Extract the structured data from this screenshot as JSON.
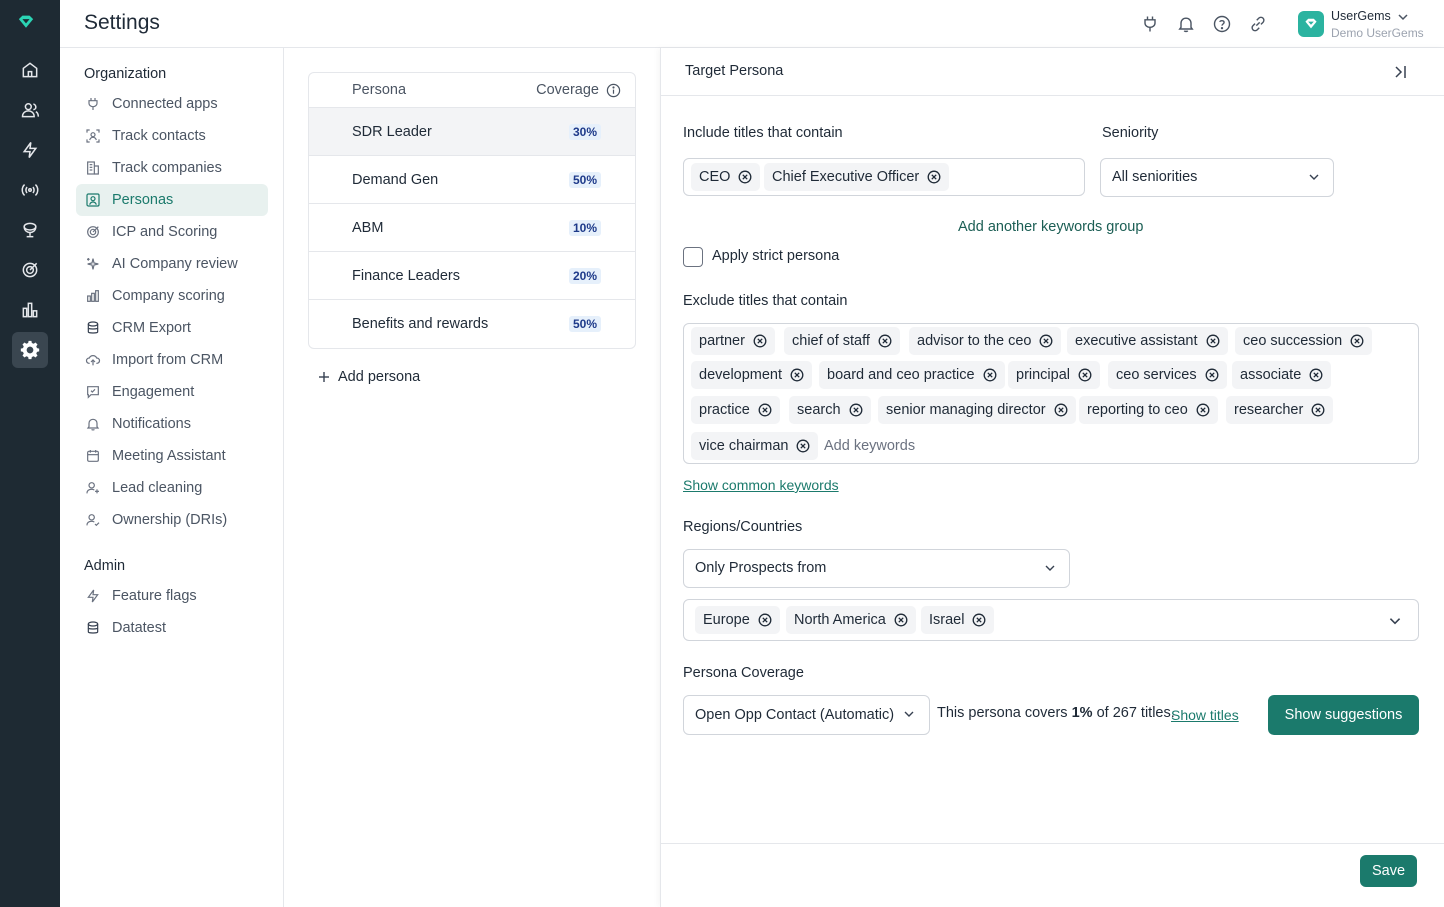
{
  "header": {
    "title": "Settings",
    "user_name": "UserGems",
    "user_org": "Demo UserGems",
    "icons": [
      "plug-icon",
      "bell-icon",
      "help-icon",
      "link-icon"
    ]
  },
  "rail": {
    "icons": [
      "home-icon",
      "people-icon",
      "bolt-icon",
      "signal-icon",
      "trophy-icon",
      "target-icon",
      "chart-icon",
      "gear-icon"
    ],
    "active": "gear-icon"
  },
  "nav": {
    "org_title": "Organization",
    "items": [
      {
        "label": "Connected apps",
        "icon": "plug-icon"
      },
      {
        "label": "Track contacts",
        "icon": "scan-user-icon"
      },
      {
        "label": "Track companies",
        "icon": "building-icon"
      },
      {
        "label": "Personas",
        "icon": "persona-icon"
      },
      {
        "label": "ICP and Scoring",
        "icon": "target-icon"
      },
      {
        "label": "AI Company review",
        "icon": "sparkle-icon"
      },
      {
        "label": "Company scoring",
        "icon": "bars-icon"
      },
      {
        "label": "CRM Export",
        "icon": "database-icon"
      },
      {
        "label": "Import from CRM",
        "icon": "cloud-upload-icon"
      },
      {
        "label": "Engagement",
        "icon": "chat-icon"
      },
      {
        "label": "Notifications",
        "icon": "bell-icon"
      },
      {
        "label": "Meeting Assistant",
        "icon": "calendar-icon"
      },
      {
        "label": "Lead cleaning",
        "icon": "user-plus-icon"
      },
      {
        "label": "Ownership (DRIs)",
        "icon": "user-check-icon"
      }
    ],
    "active_index": 3,
    "admin_title": "Admin",
    "admin_items": [
      {
        "label": "Feature flags",
        "icon": "bolt-icon"
      },
      {
        "label": "Datatest",
        "icon": "database-icon"
      }
    ]
  },
  "personas": {
    "col_persona": "Persona",
    "col_coverage": "Coverage",
    "rows": [
      {
        "name": "SDR Leader",
        "coverage": "30%"
      },
      {
        "name": "Demand Gen",
        "coverage": "50%"
      },
      {
        "name": "ABM",
        "coverage": "10%"
      },
      {
        "name": "Finance Leaders",
        "coverage": "20%"
      },
      {
        "name": "Benefits and rewards",
        "coverage": "50%"
      }
    ],
    "selected_index": 0,
    "add_label": "Add persona"
  },
  "detail": {
    "title": "Target Persona",
    "include_label": "Include titles that contain",
    "include_chips": [
      "CEO",
      "Chief Executive Officer"
    ],
    "seniority_label": "Seniority",
    "seniority_value": "All seniorities",
    "add_group_label": "Add another keywords group",
    "strict_label": "Apply strict persona",
    "exclude_label": "Exclude titles that contain",
    "exclude_chips": [
      "partner",
      "chief of staff",
      "advisor to the ceo",
      "executive assistant",
      "ceo succession",
      "development",
      "board and ceo practice",
      "principal",
      "ceo services",
      "associate",
      "practice",
      "search",
      "senior managing director",
      "reporting to ceo",
      "researcher",
      "vice chairman"
    ],
    "add_keywords_placeholder": "Add keywords",
    "show_common_label": "Show common keywords",
    "regions_label": "Regions/Countries",
    "regions_mode": "Only Prospects from",
    "region_chips": [
      "Europe",
      "North America",
      "Israel"
    ],
    "coverage_label": "Persona Coverage",
    "coverage_mode": "Open Opp Contact (Automatic)",
    "coverage_text_pre": "This persona covers ",
    "coverage_pct": "1%",
    "coverage_text_post": " of 267 titles.",
    "show_titles_label": "Show titles",
    "suggestions_label": "Show suggestions",
    "save_label": "Save"
  },
  "colors": {
    "rail_bg": "#1e2a33",
    "accent": "#1b7a6c",
    "brand": "#2bb3a0"
  }
}
